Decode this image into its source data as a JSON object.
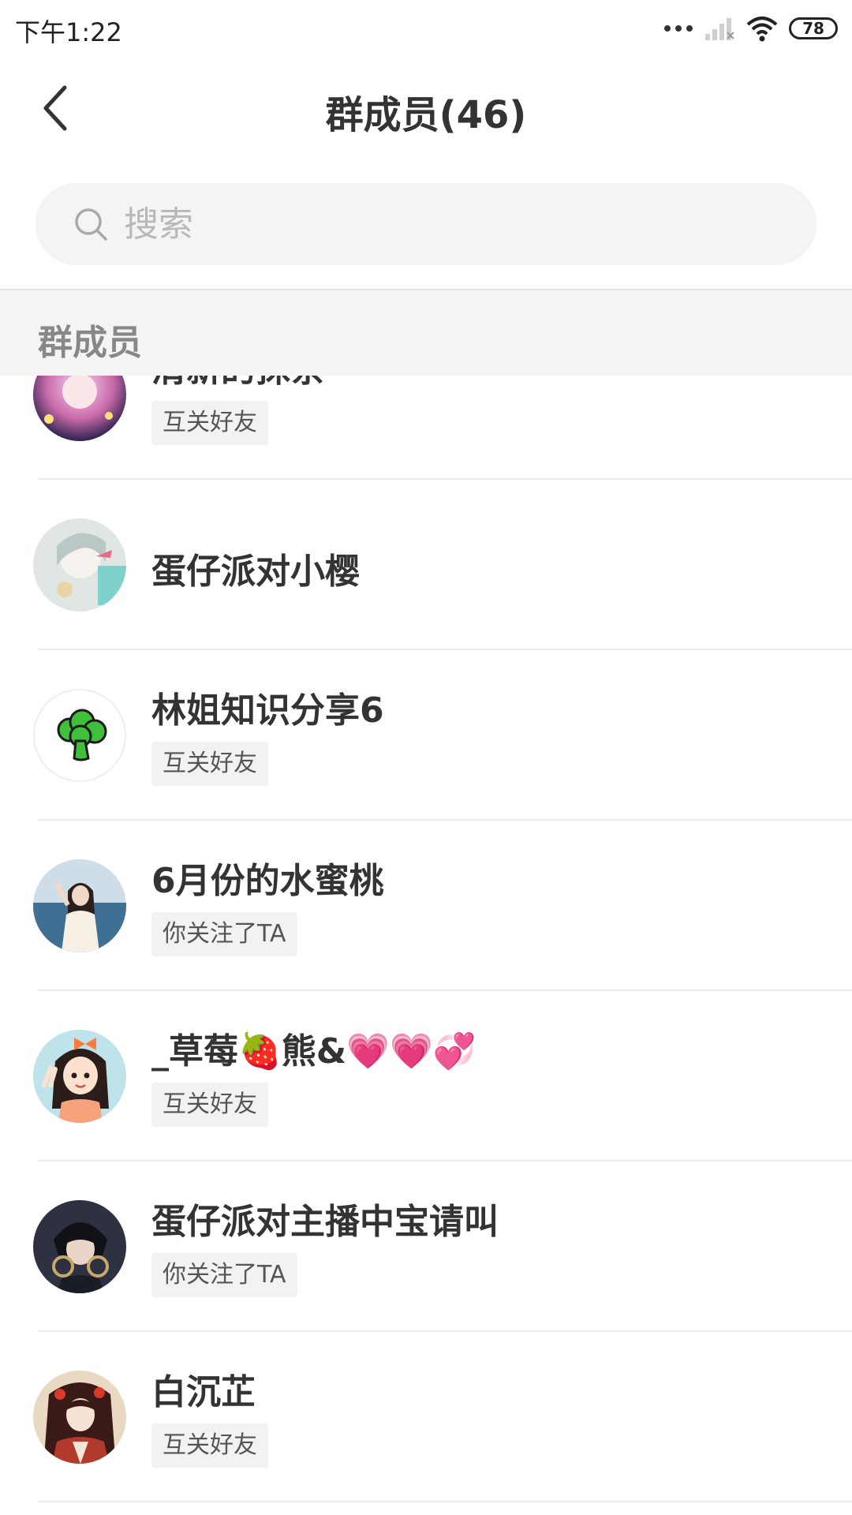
{
  "status_bar": {
    "time": "下午1:22",
    "battery": "78"
  },
  "nav": {
    "title": "群成员(46)"
  },
  "search": {
    "placeholder": "搜索"
  },
  "section": {
    "title": "群成员"
  },
  "members": [
    {
      "name": "清新的抹茶",
      "tag": "互关好友",
      "avatar_color": "#d86aa3"
    },
    {
      "name": "蛋仔派对小樱",
      "tag": "",
      "avatar_color": "#cfd9d6"
    },
    {
      "name": "林姐知识分享6",
      "tag": "互关好友",
      "avatar_color": "#ffffff"
    },
    {
      "name": "6月份的水蜜桃",
      "tag": "你关注了TA",
      "avatar_color": "#6f9bb8"
    },
    {
      "name": "_草莓🍓熊&💗💗💞",
      "tag": "互关好友",
      "avatar_color": "#f4a878"
    },
    {
      "name": "蛋仔派对主播中宝请叫",
      "tag": "你关注了TA",
      "avatar_color": "#3c3e4a"
    },
    {
      "name": "白沉芷",
      "tag": "互关好友",
      "avatar_color": "#b23a2c"
    }
  ],
  "colors": {
    "title_text": "#333333",
    "tag_bg": "#f2f2f2",
    "section_bg": "#f4f4f4",
    "search_bg": "#f4f4f4"
  },
  "icons": {
    "back": "chevron-left-icon",
    "search": "search-icon",
    "wifi": "wifi-icon",
    "signal": "signal-icon",
    "battery": "battery-icon"
  }
}
